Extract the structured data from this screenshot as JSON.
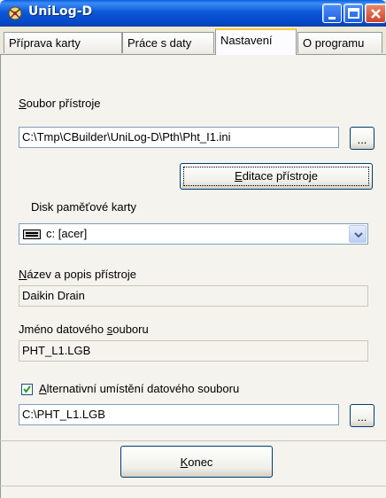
{
  "window": {
    "title": "UniLog-D",
    "icon": "app-icon",
    "controls": [
      "minimize-icon",
      "maximize-icon",
      "close-icon"
    ]
  },
  "tabs": [
    {
      "label": "Příprava karty",
      "active": false
    },
    {
      "label": "Práce s daty",
      "active": false
    },
    {
      "label": "Nastavení",
      "active": true
    },
    {
      "label": "O programu",
      "active": false
    }
  ],
  "settings": {
    "device_file_label_accel": "S",
    "device_file_label_rest": "oubor přístroje",
    "device_file_value": "C:\\Tmp\\CBuilder\\UniLog-D\\Pth\\Pht_I1.ini",
    "browse_label": "...",
    "edit_device_accel": "E",
    "edit_device_rest": "ditace přístroje",
    "card_disk_label": "Disk paměťové karty",
    "card_disk_value": "c: [acer]",
    "card_disk_icon": "drive-icon",
    "device_name_accel": "N",
    "device_name_rest": "ázev a popis přístroje",
    "device_name_value": "Daikin Drain",
    "data_file_label_pre": "Jméno datového ",
    "data_file_label_accel": "s",
    "data_file_label_post": "ouboru",
    "data_file_value": "PHT_L1.LGB",
    "alt_location_checked": true,
    "alt_location_accel": "A",
    "alt_location_rest": "lternativní umístění datového souboru",
    "alt_location_value": "C:\\PHT_L1.LGB",
    "alt_browse_label": "...",
    "close_accel": "K",
    "close_rest": "onec"
  }
}
